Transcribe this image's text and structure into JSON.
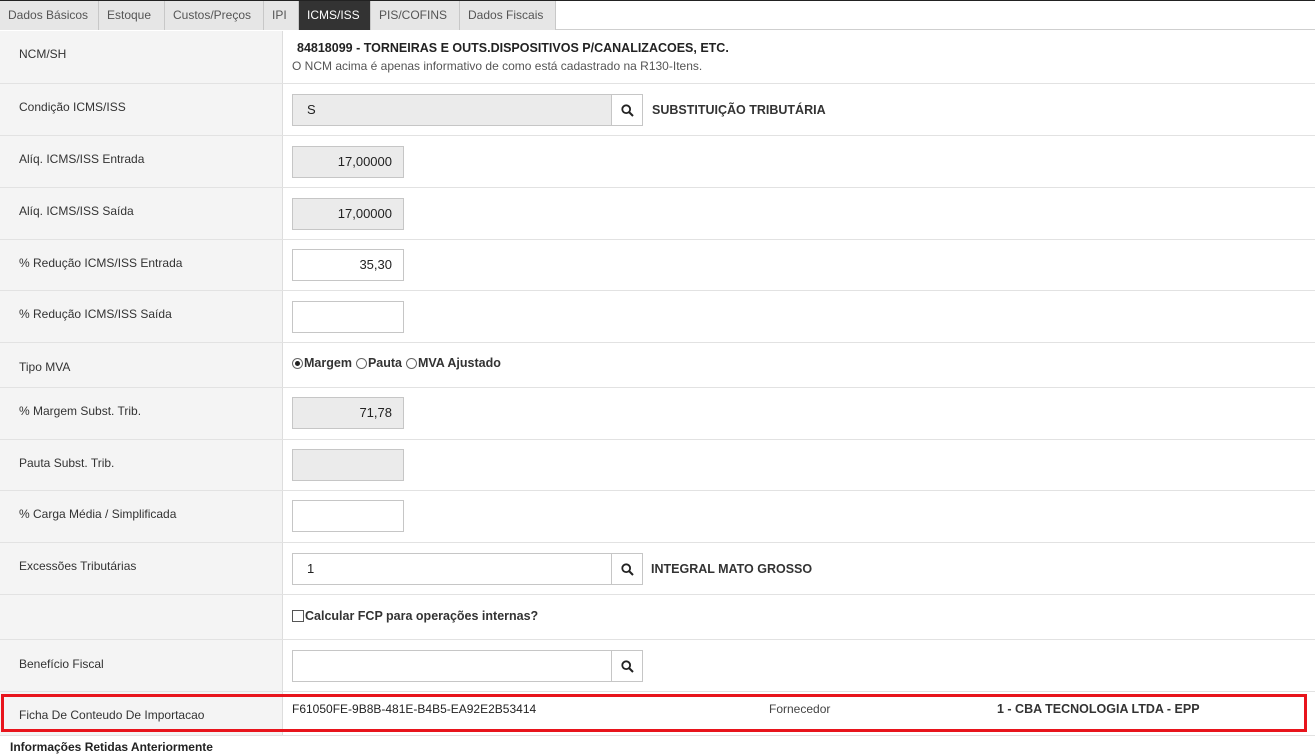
{
  "tabs": [
    "Dados Básicos",
    "Estoque",
    "Custos/Preços",
    "IPI",
    "ICMS/ISS",
    "PIS/COFINS",
    "Dados Fiscais"
  ],
  "active_tab": "ICMS/ISS",
  "ncm": {
    "label": "NCM/SH",
    "code": "84818099 - TORNEIRAS E OUTS.DISPOSITIVOS P/CANALIZACOES, ETC.",
    "note": "O NCM acima é apenas informativo de como está cadastrado na R130-Itens."
  },
  "condicao": {
    "label": "Condição ICMS/ISS",
    "value": "S",
    "description": "SUBSTITUIÇÃO TRIBUTÁRIA"
  },
  "aliq_entrada": {
    "label": "Alíq. ICMS/ISS Entrada",
    "value": "17,00000"
  },
  "aliq_saida": {
    "label": "Alíq. ICMS/ISS Saída",
    "value": "17,00000"
  },
  "reducao_entrada": {
    "label": "% Redução ICMS/ISS Entrada",
    "value": "35,30"
  },
  "reducao_saida": {
    "label": "% Redução ICMS/ISS Saída",
    "value": ""
  },
  "tipo_mva": {
    "label": "Tipo MVA",
    "options": [
      "Margem",
      "Pauta",
      "MVA Ajustado"
    ],
    "selected": "Margem"
  },
  "margem": {
    "label": "% Margem Subst. Trib.",
    "value": "71,78"
  },
  "pauta": {
    "label": "Pauta Subst. Trib.",
    "value": ""
  },
  "carga_media": {
    "label": "% Carga Média / Simplificada",
    "value": ""
  },
  "excecoes": {
    "label": "Excessões Tributárias",
    "value": "1",
    "description": "INTEGRAL MATO GROSSO"
  },
  "fcp": {
    "label": "Calcular FCP para operações internas?",
    "checked": false
  },
  "beneficio": {
    "label": "Benefício Fiscal",
    "value": ""
  },
  "ficha": {
    "label": "Ficha De Conteudo De Importacao",
    "value": "F61050FE-9B8B-481E-B4B5-EA92E2B53414",
    "fornecedor_label": "Fornecedor",
    "fornecedor_value": "1 - CBA TECNOLOGIA LTDA - EPP"
  },
  "footer_title": "Informações Retidas Anteriormente",
  "colors": {
    "highlight": "#e8141c",
    "active_tab_bg": "#333333",
    "readonly_bg": "#ebebeb"
  },
  "icons": {
    "lookup": "search-icon"
  }
}
